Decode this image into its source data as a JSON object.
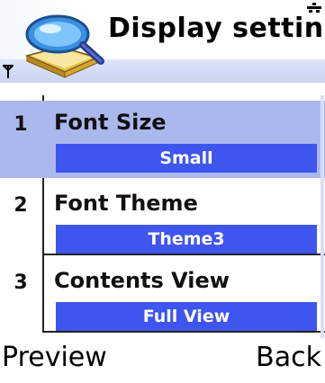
{
  "header": {
    "title": "Display setting",
    "app_icon": "magnifier-folder-icon",
    "signal_icon": "signal-antenna-icon",
    "battery_icon": "battery-indicator-icon"
  },
  "list": {
    "selected_index": 0,
    "items": [
      {
        "number": "1",
        "label": "Font Size",
        "value": "Small"
      },
      {
        "number": "2",
        "label": "Font Theme",
        "value": "Theme3"
      },
      {
        "number": "3",
        "label": "Contents View",
        "value": "Full View"
      }
    ]
  },
  "softkeys": {
    "left": "Preview",
    "right": "Back"
  },
  "colors": {
    "highlight": "#aab8ed",
    "value_bar": "#3f55f0",
    "header_bar": "#c8d3f2"
  }
}
